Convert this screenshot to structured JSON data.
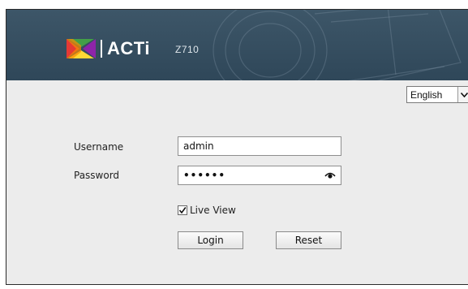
{
  "header": {
    "brand": "ACTi",
    "model": "Z710"
  },
  "language": {
    "selected": "English"
  },
  "form": {
    "username_label": "Username",
    "username_value": "admin",
    "password_label": "Password",
    "password_value": "••••••",
    "live_view_label": "Live View",
    "live_view_checked": true,
    "login_label": "Login",
    "reset_label": "Reset"
  },
  "icons": {
    "logo": "acti-logo-icon",
    "eye": "eye-icon",
    "dropdown": "chevron-down-icon",
    "check": "checkmark-icon"
  }
}
